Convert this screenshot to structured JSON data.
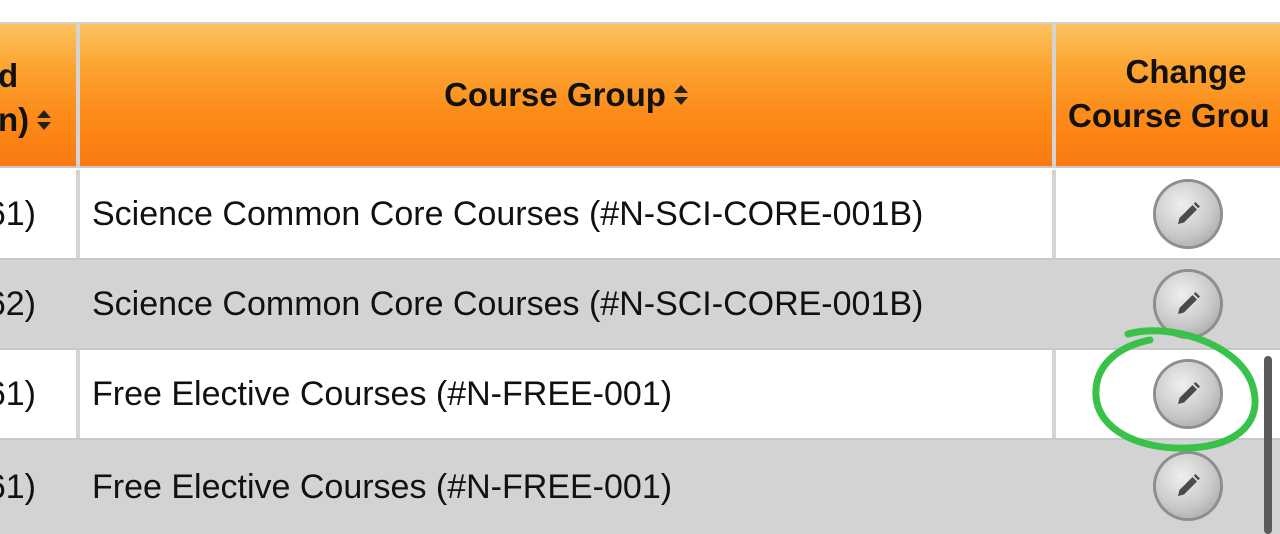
{
  "table": {
    "headers": {
      "col1_line1": "d",
      "col1_line2": "n)",
      "course_group": "Course Group",
      "change_line1": "Change",
      "change_line2": "Course Grou"
    },
    "rows": [
      {
        "col1": "61)",
        "course_group": "Science Common Core Courses (#N-SCI-CORE-001B)"
      },
      {
        "col1": "62)",
        "course_group": "Science Common Core Courses (#N-SCI-CORE-001B)"
      },
      {
        "col1": "61)",
        "course_group": "Free Elective Courses (#N-FREE-001)"
      },
      {
        "col1": "61)",
        "course_group": "Free Elective Courses (#N-FREE-001)"
      }
    ]
  },
  "icons": {
    "sort": "sort-icon",
    "edit": "pencil-icon"
  },
  "colors": {
    "header_orange": "#fc8a18",
    "alt_row_gray": "#d3d3d3",
    "annotation_green": "#39c24a"
  }
}
